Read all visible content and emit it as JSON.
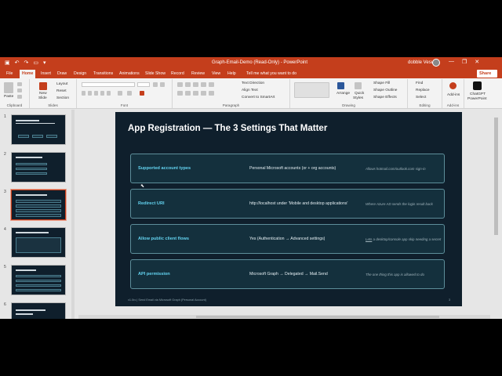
{
  "window": {
    "title": "Graph-Email-Demo (Read-Only) - PowerPoint",
    "user": "dobble Vesu",
    "qat": [
      "▣",
      "↶",
      "↷",
      "▭",
      "▾"
    ],
    "controls": [
      "—",
      "❐",
      "✕"
    ]
  },
  "tabs": [
    "File",
    "Home",
    "Insert",
    "Draw",
    "Design",
    "Transitions",
    "Animations",
    "Slide Show",
    "Record",
    "Review",
    "View",
    "Help"
  ],
  "active_tab": "Home",
  "tell_me": "Tell me what you want to do",
  "share": "Share",
  "ribbon": {
    "clipboard": {
      "label": "Clipboard",
      "paste": "Paste"
    },
    "slides": {
      "label": "Slides",
      "new_slide": "New",
      "new_slide2": "Slide",
      "layout": "Layout",
      "reset": "Reset",
      "section": "Section"
    },
    "font": {
      "label": "Font"
    },
    "paragraph": {
      "label": "Paragraph",
      "text_direction": "Text Direction",
      "align_text": "Align Text",
      "convert_smartart": "Convert to SmartArt"
    },
    "drawing": {
      "label": "Drawing",
      "arrange": "Arrange",
      "quick_styles": "Quick",
      "quick_styles2": "Styles",
      "shape_fill": "Shape Fill",
      "shape_outline": "Shape Outline",
      "shape_effects": "Shape Effects"
    },
    "editing": {
      "label": "Editing",
      "find": "Find",
      "replace": "Replace",
      "select": "Select"
    },
    "addins": {
      "label": "Add-ins",
      "addins_btn": "Add-ins",
      "chatgpt1": "ChatGPT",
      "chatgpt2": "PowerPoint"
    }
  },
  "thumbnails": [
    "1",
    "2",
    "3",
    "4",
    "5",
    "6"
  ],
  "selected_slide": 3,
  "slide": {
    "title": "App Registration — The 3 Settings That Matter",
    "rows": [
      {
        "label": "Supported account types",
        "value": "Personal Microsoft accounts (or + org accounts)",
        "note": "Allows hotmail.com/outlook.com sign-in"
      },
      {
        "label": "Redirect URI",
        "value": "http://localhost under 'Mobile and desktop applications'",
        "note": "Where Azure AD sends the login result back"
      },
      {
        "label": "Allow public client flows",
        "value": "Yes (Authentication → Advanced settings)",
        "note_prefix": "Lets",
        "note": " a desktop/console app skip needing a secret"
      },
      {
        "label": "API permission",
        "value": "Microsoft Graph → Delegated → Mail.Send",
        "note": "The one thing this app is allowed to do"
      }
    ],
    "footer_left": "v1.0rc | Send Email via Microsoft Graph (Personal Account)",
    "footer_right": "3"
  },
  "colors": {
    "accent": "#c43e1c",
    "slide_bg": "#0f1f2c",
    "label": "#63d3f0"
  }
}
